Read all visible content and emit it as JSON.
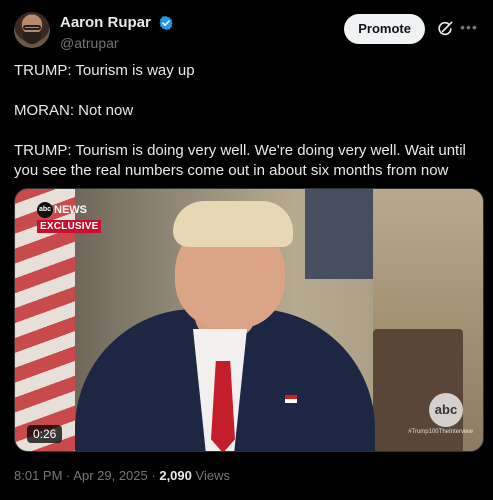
{
  "author": {
    "display_name": "Aaron Rupar",
    "handle": "@atrupar",
    "verified": true
  },
  "actions": {
    "promote_label": "Promote",
    "grok_icon": "grok-icon",
    "more_icon": "more-icon"
  },
  "post": {
    "paragraphs": [
      "TRUMP: Tourism is way up",
      "MORAN: Not now",
      "TRUMP: Tourism is doing very well. We're doing very well. Wait until you see the real numbers come out in about six months from now"
    ]
  },
  "video": {
    "duration": "0:26",
    "overlay_brand": "abc",
    "overlay_news": "NEWS",
    "overlay_exclusive": "EXCLUSIVE",
    "watermark": "abc",
    "hashtag": "#Trump100TheInterview"
  },
  "meta": {
    "time": "8:01 PM",
    "date": "Apr 29, 2025",
    "separator": "·",
    "views_count": "2,090",
    "views_label": "Views"
  },
  "colors": {
    "background": "#000000",
    "text": "#e7e9ea",
    "muted": "#71767b",
    "verified": "#1d9bf0",
    "promote_bg": "#eff3f4"
  }
}
